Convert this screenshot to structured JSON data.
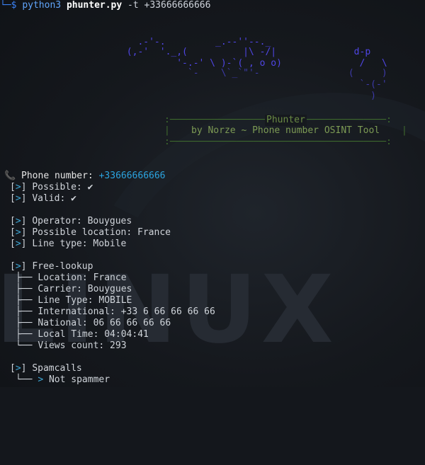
{
  "prompt": {
    "corner": "└─$",
    "command": "python3",
    "script": "phunter.py",
    "args": "-t +33666666666"
  },
  "banner": {
    "art_lines": [
      "         .-'-.         _.--''--._",
      "       (,-'  '._,(          |\\ -/|              d-p",
      "                '-.-' \\ )-`( , o o)              /   \\",
      "                  `-    \\`_`\"'-                (     )",
      "                                                 `-(-'",
      "                                                   )"
    ],
    "title": "Phunter",
    "subtitle": "by Norze ~ Phone number OSINT Tool",
    "box_top": ":───────────────────────────────────────:",
    "box_side": "|",
    "box_bottom": ":───────────────────────────────────────:"
  },
  "result": {
    "phone_label": "Phone number: ",
    "phone_value": "+33666666666",
    "possible": "Possible: ✔",
    "valid": "Valid: ✔",
    "operator": "Operator: Bouygues",
    "location": "Possible location: France",
    "line_type": "Line type: Mobile",
    "free_lookup_header": "Free-lookup",
    "free_lookup": [
      "Location: France",
      "Carrier: Bouygues",
      "Line Type: MOBILE",
      "International: +33 6 66 66 66 66",
      "National: 06 66 66 66 66",
      "Local Time: 04:04:41",
      "Views count: 293"
    ],
    "spamcalls_header": "Spamcalls",
    "spamcalls_result": "Not spammer"
  },
  "watermark": "LINUX",
  "colors": {
    "accent": "#3fa7d6",
    "phone_value": "#2ba4e0",
    "banner": "#6a8a44",
    "ascii_art": "#4f46e5"
  }
}
